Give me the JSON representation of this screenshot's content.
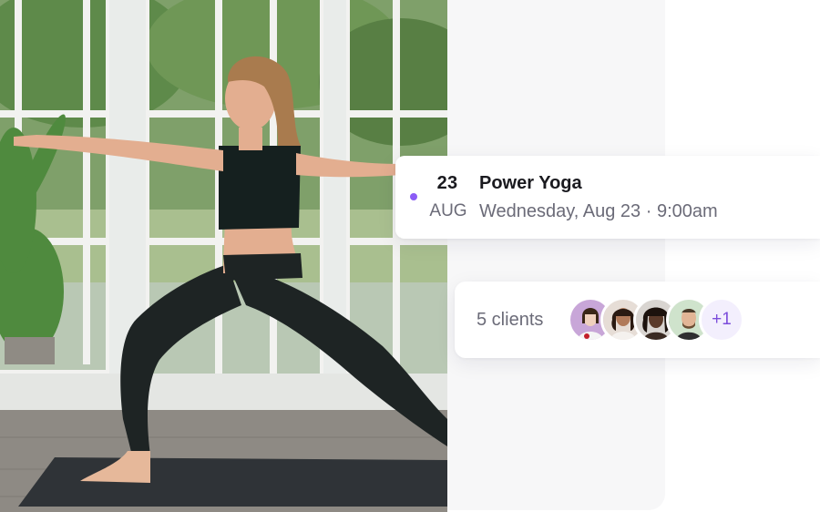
{
  "event": {
    "day": "23",
    "month": "AUG",
    "title": "Power Yoga",
    "datetime": "Wednesday, Aug 23 · 9:00am",
    "dot_color": "#8b5cf6"
  },
  "clients": {
    "label": "5 clients",
    "more": "+1",
    "avatars": [
      "client-avatar-1",
      "client-avatar-2",
      "client-avatar-3",
      "client-avatar-4"
    ]
  },
  "photo": {
    "subject": "yoga-warrior-pose-photo"
  },
  "colors": {
    "accent": "#8b5cf6",
    "text_primary": "#1a1a1f",
    "text_secondary": "#6b6b78"
  }
}
